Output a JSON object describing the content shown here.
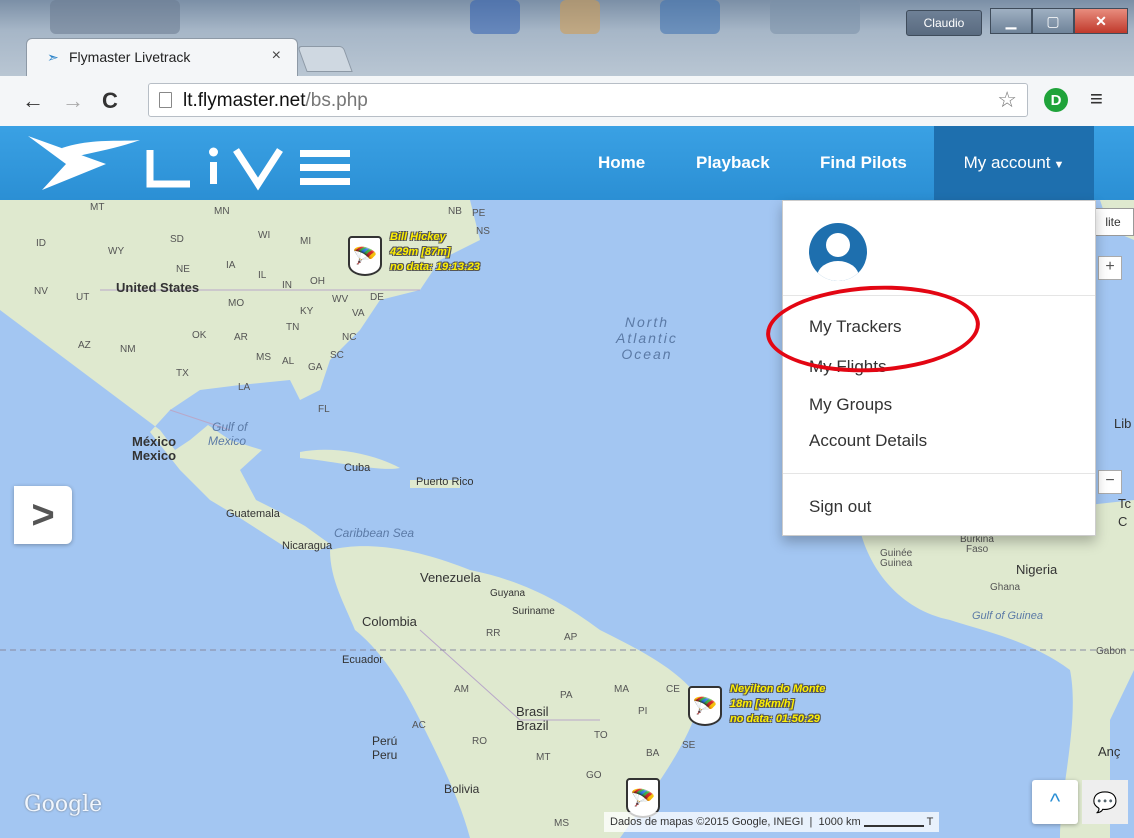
{
  "window": {
    "user_label": "Claudio",
    "minimize_icon": "minimize-icon",
    "maximize_icon": "maximize-icon",
    "close_icon": "close-icon"
  },
  "tab": {
    "title": "Flymaster Livetrack",
    "close": "×"
  },
  "toolbar": {
    "back": "←",
    "forward": "→",
    "reload": "C",
    "url_host": "lt.flymaster.net",
    "url_path": "/bs.php",
    "star": "☆",
    "extension_letter": "D",
    "menu": "≡"
  },
  "navbar": {
    "logo_text": "LiVE",
    "links": [
      "Home",
      "Playback",
      "Find Pilots"
    ],
    "account_label": "My account",
    "accent_color": "#2b8fd4"
  },
  "dropdown": {
    "items": [
      "My Trackers",
      "My Flights",
      "My Groups",
      "Account Details"
    ],
    "sign_out": "Sign out"
  },
  "map": {
    "labels": {
      "united_states": "United States",
      "mexico1": "México",
      "mexico2": "Mexico",
      "gulf": "Gulf of",
      "gulf2": "Mexico",
      "cuba": "Cuba",
      "puerto_rico": "Puerto Rico",
      "guatemala": "Guatemala",
      "nicaragua": "Nicaragua",
      "caribbean": "Caribbean Sea",
      "venezuela": "Venezuela",
      "guyana": "Guyana",
      "suriname": "Suriname",
      "colombia": "Colombia",
      "ecuador": "Ecuador",
      "brasil": "Brasil",
      "brazil": "Brazil",
      "peru1": "Perú",
      "peru2": "Peru",
      "bolivia": "Bolivia",
      "north": "North",
      "atlantic": "Atlantic",
      "ocean": "Ocean",
      "nigeria": "Nigeria",
      "ghana": "Ghana",
      "burkina": "Burkina",
      "faso": "Faso",
      "guinee": "Guinée",
      "guinea": "Guinea",
      "gulf_guinea": "Gulf of Guinea",
      "gabon": "Gabon",
      "ang": "Anç",
      "lite": "lite",
      "to": "Tc",
      "ci": "C",
      "lib": "Lib"
    },
    "states": [
      "MT",
      "MN",
      "SD",
      "WY",
      "NE",
      "IA",
      "IL",
      "IN",
      "OH",
      "MI",
      "WI",
      "NB",
      "PE",
      "NS",
      "NV",
      "UT",
      "MO",
      "KY",
      "WV",
      "VA",
      "DE",
      "OK",
      "AR",
      "TN",
      "NC",
      "AZ",
      "NM",
      "TX",
      "MS",
      "AL",
      "GA",
      "SC",
      "LA",
      "FL",
      "AM",
      "PA",
      "MA",
      "CE",
      "PI",
      "AC",
      "RO",
      "TO",
      "BA",
      "SE",
      "MT",
      "GO",
      "MS",
      "AP",
      "RR",
      "ID"
    ],
    "pilots": [
      {
        "name": "Bill Hickey",
        "alt": "429m [87m]",
        "status": "no data: 19:13:23"
      },
      {
        "name": "Neyilton do Monte",
        "alt": "18m [8km/h]",
        "status": "no data: 01:50:29"
      }
    ],
    "google": "Google",
    "attribution": "Dados de mapas ©2015 Google, INEGI",
    "scale": "1000 km",
    "scale_end": "T",
    "side_toggle": ">",
    "scroll_top": "^",
    "zoom_in": "+",
    "zoom_out": "−"
  }
}
